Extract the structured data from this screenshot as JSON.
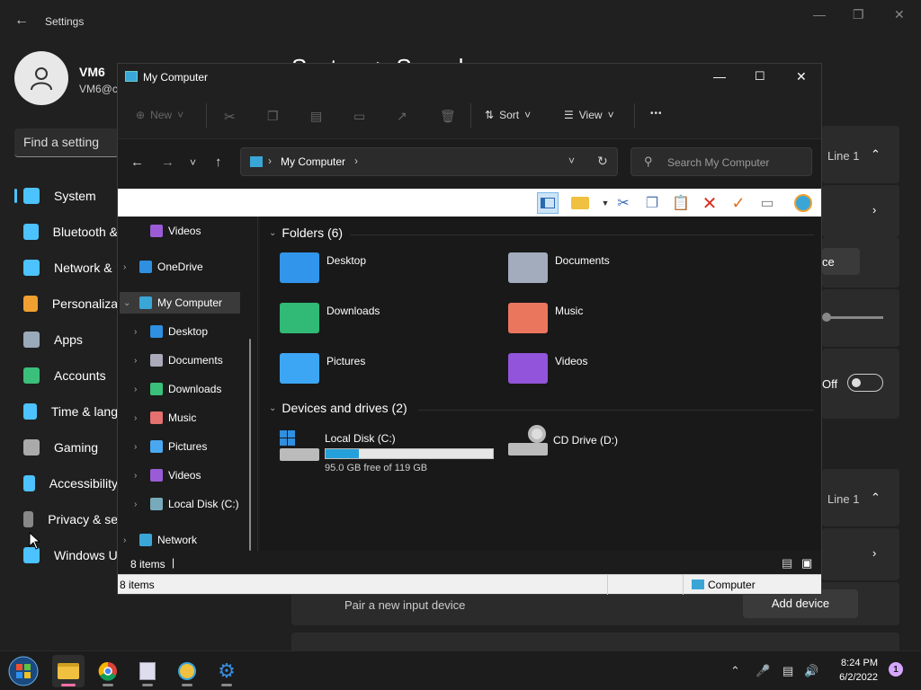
{
  "settings": {
    "title": "Settings",
    "header": "System  >  Sound",
    "user_name": "VM6",
    "user_email": "VM6@c",
    "search_placeholder": "Find a setting",
    "nav": [
      {
        "label": "System",
        "icon": "monitor-icon",
        "color": "#4cc2ff"
      },
      {
        "label": "Bluetooth &",
        "icon": "bluetooth-icon",
        "color": "#4cc2ff"
      },
      {
        "label": "Network &",
        "icon": "wifi-icon",
        "color": "#4cc2ff"
      },
      {
        "label": "Personaliza",
        "icon": "brush-icon",
        "color": "#f0a030"
      },
      {
        "label": "Apps",
        "icon": "apps-icon",
        "color": "#9ab"
      },
      {
        "label": "Accounts",
        "icon": "person-icon",
        "color": "#3ac07a"
      },
      {
        "label": "Time & lang",
        "icon": "clock-icon",
        "color": "#4cc2ff"
      },
      {
        "label": "Gaming",
        "icon": "gamepad-icon",
        "color": "#aaa"
      },
      {
        "label": "Accessibility",
        "icon": "accessibility-icon",
        "color": "#4cc2ff"
      },
      {
        "label": "Privacy & se",
        "icon": "shield-icon",
        "color": "#888"
      },
      {
        "label": "Windows U",
        "icon": "update-icon",
        "color": "#4cc2ff"
      }
    ],
    "right_items": {
      "line1_a": "Line 1",
      "partial_btn": "ce",
      "off_label": "Off",
      "line1_b": "Line 1",
      "pair_text": "Pair a new input device",
      "add_device": "Add device"
    }
  },
  "explorer": {
    "title": "My Computer",
    "cmd": {
      "new": "New",
      "sort": "Sort",
      "view": "View",
      "more": "•••"
    },
    "address": "My Computer",
    "search_placeholder": "Search My Computer",
    "tree": [
      {
        "label": "Videos",
        "color": "#9a5cd6",
        "indent": 1,
        "chev": ""
      },
      {
        "label": "OneDrive",
        "color": "#2f8fe0",
        "indent": 0,
        "chev": "›"
      },
      {
        "label": "My Computer",
        "color": "#3aa6d8",
        "indent": 0,
        "chev": "⌄",
        "selected": true
      },
      {
        "label": "Desktop",
        "color": "#2f8fe0",
        "indent": 1,
        "chev": "›"
      },
      {
        "label": "Documents",
        "color": "#aab",
        "indent": 1,
        "chev": "›"
      },
      {
        "label": "Downloads",
        "color": "#3ac07a",
        "indent": 1,
        "chev": "›"
      },
      {
        "label": "Music",
        "color": "#e57070",
        "indent": 1,
        "chev": "›"
      },
      {
        "label": "Pictures",
        "color": "#4aa8f0",
        "indent": 1,
        "chev": "›"
      },
      {
        "label": "Videos",
        "color": "#9a5cd6",
        "indent": 1,
        "chev": "›"
      },
      {
        "label": "Local Disk (C:)",
        "color": "#7ab",
        "indent": 1,
        "chev": "›"
      },
      {
        "label": "Network",
        "color": "#3aa6d8",
        "indent": 0,
        "chev": "›"
      }
    ],
    "folders_header": "Folders (6)",
    "folders": [
      {
        "label": "Desktop",
        "color": "#2f8fe0",
        "icon": "desktop-folder-icon"
      },
      {
        "label": "Documents",
        "color": "#9aa4b4",
        "icon": "documents-folder-icon"
      },
      {
        "label": "Downloads",
        "color": "#2fb070",
        "icon": "downloads-folder-icon"
      },
      {
        "label": "Music",
        "color": "#e0705a",
        "icon": "music-folder-icon"
      },
      {
        "label": "Pictures",
        "color": "#3a9ee8",
        "icon": "pictures-folder-icon"
      },
      {
        "label": "Videos",
        "color": "#8a50d0",
        "icon": "videos-folder-icon"
      }
    ],
    "drives_header": "Devices and drives (2)",
    "drives": [
      {
        "label": "Local Disk (C:)",
        "free": "95.0 GB free of 119 GB",
        "used_fraction": 0.2
      },
      {
        "label": "CD Drive (D:)"
      }
    ],
    "status_items": "8 items",
    "status2_items": "8 items",
    "status2_zone": "Computer"
  },
  "taskbar": {
    "time": "8:24 PM",
    "date": "6/2/2022",
    "notif_count": "1"
  }
}
